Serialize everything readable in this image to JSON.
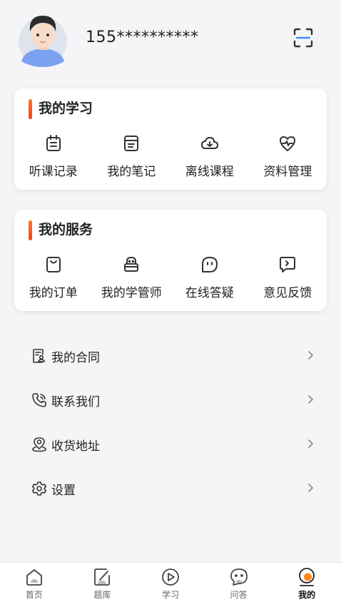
{
  "user": {
    "phone": "155**********"
  },
  "study": {
    "title": "我的学习",
    "items": [
      {
        "label": "听课记录",
        "icon": "calendar-icon"
      },
      {
        "label": "我的笔记",
        "icon": "notebook-icon"
      },
      {
        "label": "离线课程",
        "icon": "cloud-download-icon"
      },
      {
        "label": "资料管理",
        "icon": "heart-pulse-icon"
      }
    ]
  },
  "services": {
    "title": "我的服务",
    "items": [
      {
        "label": "我的订单",
        "icon": "shopping-bag-icon"
      },
      {
        "label": "我的学管师",
        "icon": "tutor-icon"
      },
      {
        "label": "在线答疑",
        "icon": "chat-face-icon"
      },
      {
        "label": "意见反馈",
        "icon": "feedback-icon"
      }
    ]
  },
  "menu": [
    {
      "label": "我的合同",
      "icon": "contract-icon"
    },
    {
      "label": "联系我们",
      "icon": "phone-icon"
    },
    {
      "label": "收货地址",
      "icon": "location-pin-icon"
    },
    {
      "label": "设置",
      "icon": "gear-icon"
    }
  ],
  "tabs": [
    {
      "label": "首页",
      "icon": "home-icon"
    },
    {
      "label": "题库",
      "icon": "question-bank-icon"
    },
    {
      "label": "学习",
      "icon": "play-icon"
    },
    {
      "label": "问答",
      "icon": "qa-icon"
    },
    {
      "label": "我的",
      "icon": "profile-icon",
      "active": true
    }
  ],
  "colors": {
    "accent": "#ff6a1a",
    "icon": "#333333"
  }
}
